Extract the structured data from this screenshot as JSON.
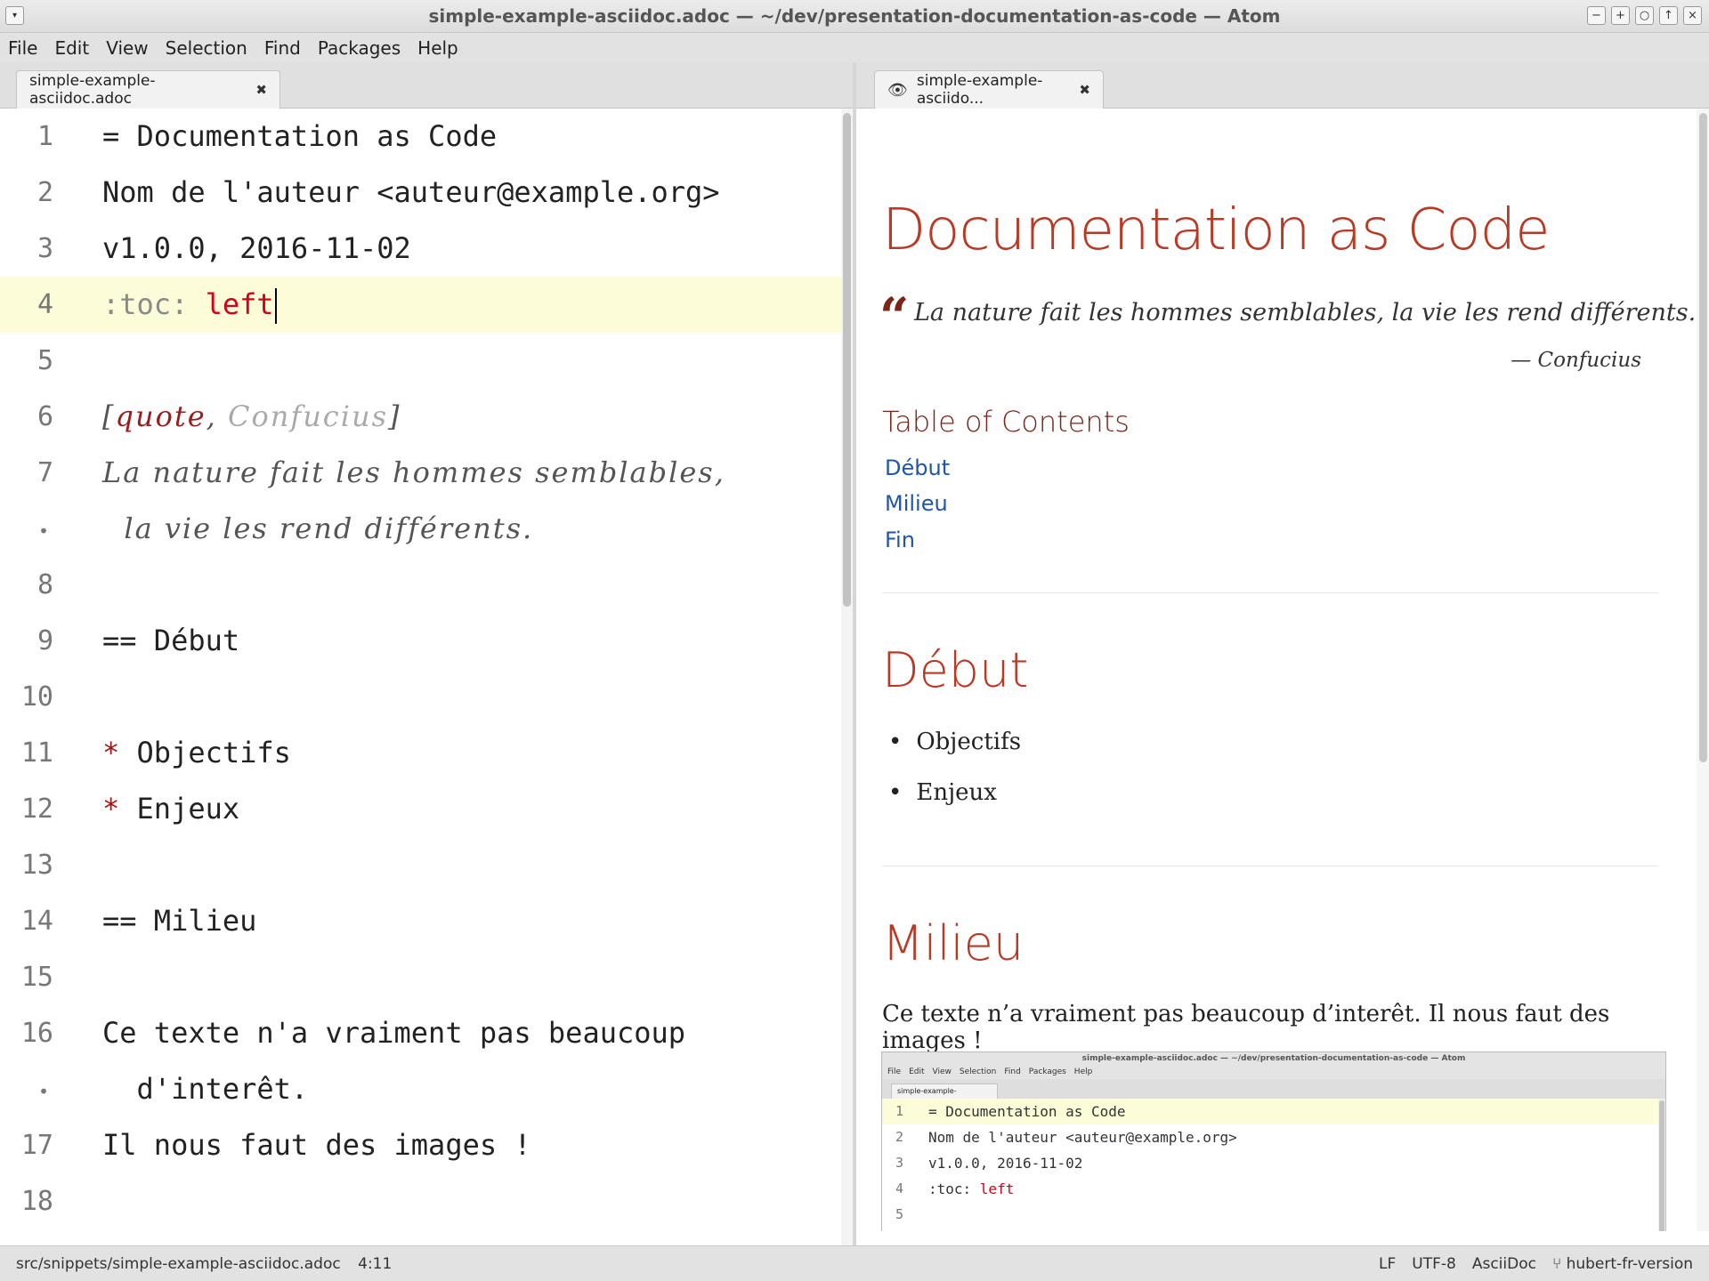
{
  "window": {
    "title": "simple-example-asciidoc.adoc — ~/dev/presentation-documentation-as-code — Atom",
    "menu_icon": "▾",
    "controls": [
      "−",
      "+",
      "○",
      "↑",
      "×"
    ]
  },
  "menubar": [
    "File",
    "Edit",
    "View",
    "Selection",
    "Find",
    "Packages",
    "Help"
  ],
  "tabs": {
    "editor": {
      "label": "simple-example-asciidoc.adoc",
      "close": "✖"
    },
    "preview": {
      "label": "simple-example-asciido...",
      "close": "✖",
      "icon": "👁"
    }
  },
  "editor": {
    "lines": [
      {
        "n": "1",
        "text": "= Documentation as Code"
      },
      {
        "n": "2",
        "text": "Nom de l'auteur <auteur@example.org>"
      },
      {
        "n": "3",
        "text": "v1.0.0, 2016-11-02"
      },
      {
        "n": "4",
        "attr": ":toc: ",
        "value": "left"
      },
      {
        "n": "5",
        "text": ""
      },
      {
        "n": "6",
        "open": "[",
        "kw": "quote",
        "sep": ", ",
        "arg": "Confucius",
        "close": "]"
      },
      {
        "n": "7",
        "text": "La nature fait les hommes semblables,"
      },
      {
        "n": "•",
        "text": "  la vie les rend différents."
      },
      {
        "n": "8",
        "text": ""
      },
      {
        "n": "9",
        "text": "== Début"
      },
      {
        "n": "10",
        "text": ""
      },
      {
        "n": "11",
        "star": "*",
        "text": " Objectifs"
      },
      {
        "n": "12",
        "star": "*",
        "text": " Enjeux"
      },
      {
        "n": "13",
        "text": ""
      },
      {
        "n": "14",
        "text": "== Milieu"
      },
      {
        "n": "15",
        "text": ""
      },
      {
        "n": "16",
        "text": "Ce texte n'a vraiment pas beaucoup"
      },
      {
        "n": "•",
        "text": "  d'interêt."
      },
      {
        "n": "17",
        "text": "Il nous faut des images !"
      },
      {
        "n": "18",
        "text": ""
      }
    ]
  },
  "preview": {
    "title": "Documentation as Code",
    "quote_mark": "“",
    "quote": "La nature fait les hommes semblables, la vie les rend différents.",
    "attribution": "— Confucius",
    "toc_title": "Table of Contents",
    "toc": [
      "Début",
      "Milieu",
      "Fin"
    ],
    "section1": {
      "title": "Début",
      "items": [
        "Objectifs",
        "Enjeux"
      ]
    },
    "section2": {
      "title": "Milieu",
      "para": "Ce texte n’a vraiment pas beaucoup d’interêt. Il nous faut des images !"
    },
    "thumbnail": {
      "title": "simple-example-asciidoc.adoc — ~/dev/presentation-documentation-as-code — Atom",
      "menu": [
        "File",
        "Edit",
        "View",
        "Selection",
        "Find",
        "Packages",
        "Help"
      ],
      "tab": "simple-example-asciidoc.adoc ✖",
      "lines": [
        {
          "n": "1",
          "text": "= Documentation as Code"
        },
        {
          "n": "2",
          "text": "Nom de l'auteur <auteur@example.org>"
        },
        {
          "n": "3",
          "text": "v1.0.0, 2016-11-02"
        },
        {
          "n": "4",
          "attr": ":toc: ",
          "value": "left"
        },
        {
          "n": "5",
          "text": ""
        }
      ]
    }
  },
  "statusbar": {
    "path": "src/snippets/simple-example-asciidoc.adoc",
    "cursor": "4:11",
    "line_ending": "LF",
    "encoding": "UTF-8",
    "grammar": "AsciiDoc",
    "branch_icon": "⑂",
    "branch": "hubert-fr-version"
  }
}
